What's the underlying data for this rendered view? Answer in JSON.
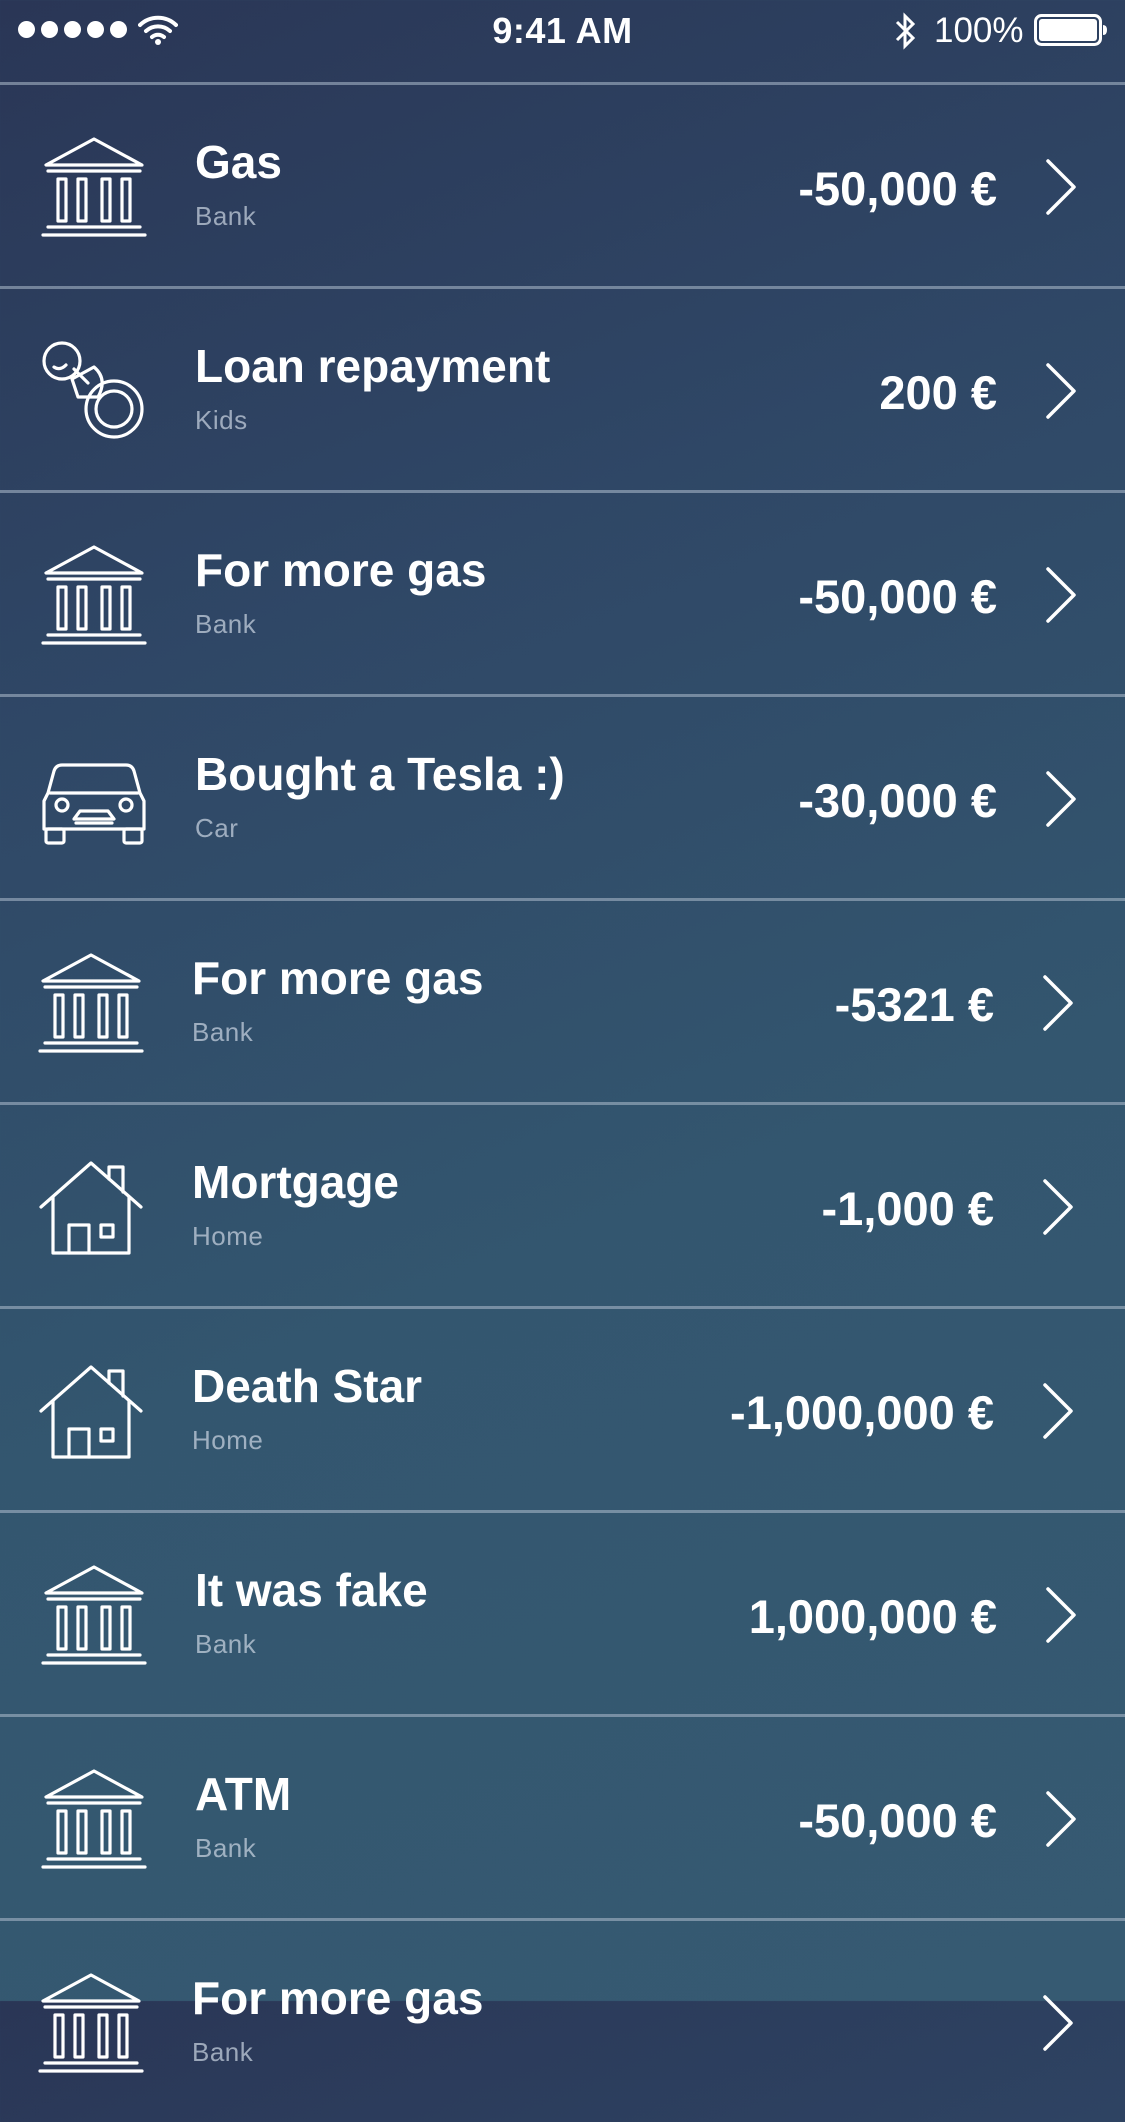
{
  "status_bar": {
    "time": "9:41 AM",
    "battery_percent": "100%",
    "signal_bars": 5,
    "wifi_icon": "wifi-icon",
    "bluetooth_icon": "bluetooth-icon",
    "battery_icon": "battery-full-icon"
  },
  "transactions": [
    {
      "title": "Gas",
      "category": "Bank",
      "amount": "-50,000 €",
      "icon": "bank-icon"
    },
    {
      "title": "Loan repayment",
      "category": "Kids",
      "amount": "200 €",
      "icon": "pacifier-icon"
    },
    {
      "title": "For more gas",
      "category": "Bank",
      "amount": "-50,000 €",
      "icon": "bank-icon"
    },
    {
      "title": "Bought a Tesla :)",
      "category": "Car",
      "amount": "-30,000 €",
      "icon": "car-icon"
    },
    {
      "title": "For more gas",
      "category": "Bank",
      "amount": "-5321 €",
      "icon": "bank-icon"
    },
    {
      "title": "Mortgage",
      "category": "Home",
      "amount": "-1,000 €",
      "icon": "home-icon"
    },
    {
      "title": "Death Star",
      "category": "Home",
      "amount": "-1,000,000 €",
      "icon": "home-icon"
    },
    {
      "title": "It was fake",
      "category": "Bank",
      "amount": "1,000,000 €",
      "icon": "bank-icon"
    },
    {
      "title": "ATM",
      "category": "Bank",
      "amount": "-50,000 €",
      "icon": "bank-icon"
    },
    {
      "title": "For more gas",
      "category": "Bank",
      "amount": "",
      "icon": "bank-icon"
    }
  ],
  "colors": {
    "background_top": "#2a3656",
    "background_bottom": "#365a72",
    "separator": "#afbecd",
    "text_primary": "#ffffff",
    "text_secondary": "#cdd7e4"
  }
}
